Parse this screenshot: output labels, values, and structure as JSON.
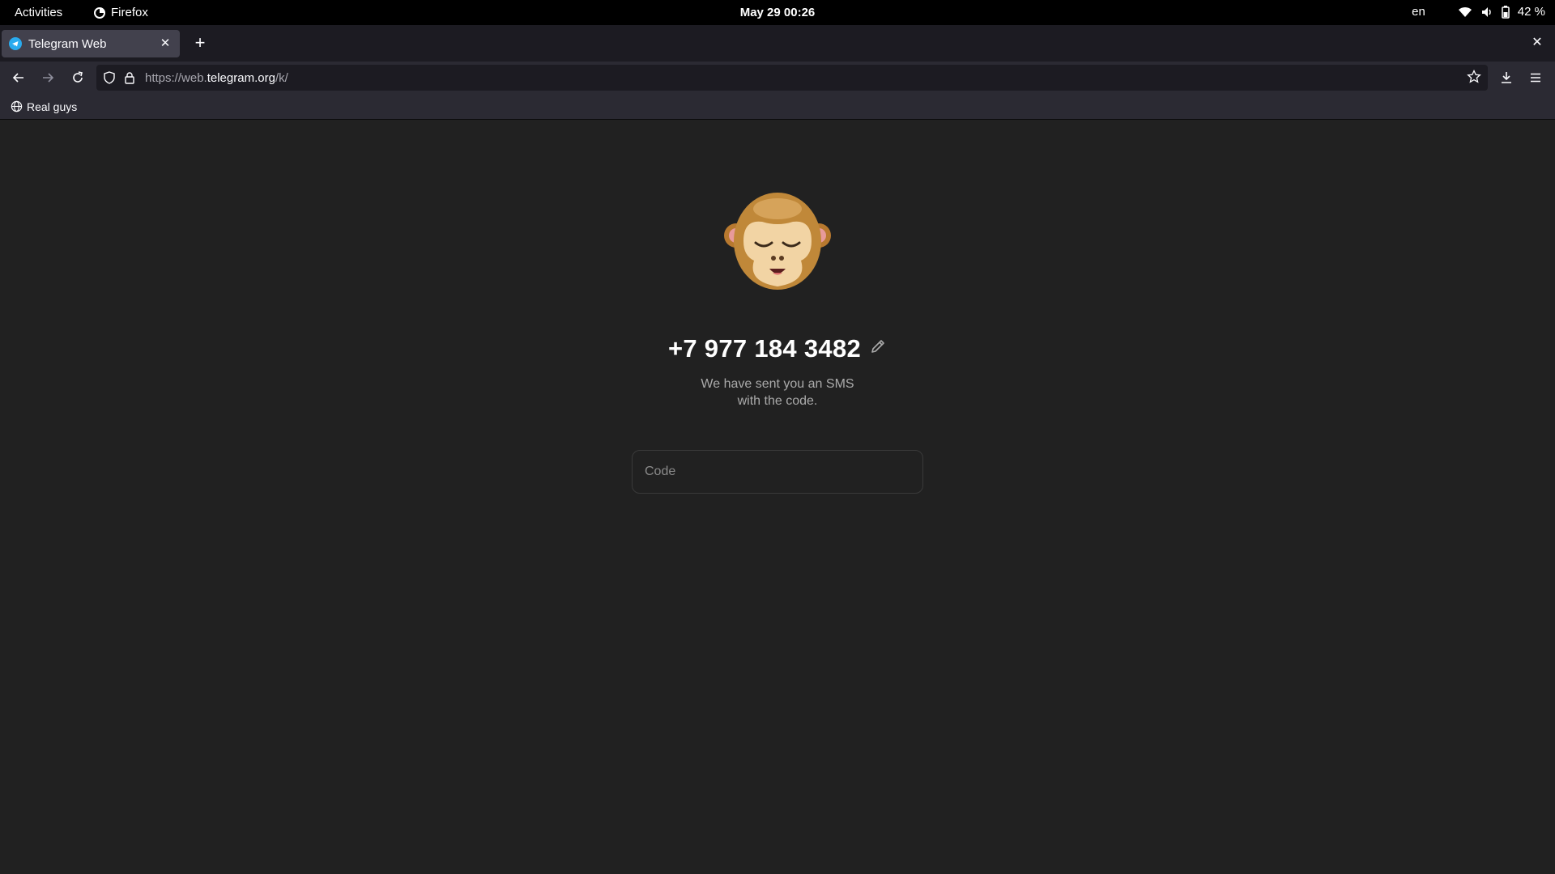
{
  "system": {
    "activities": "Activities",
    "app_name": "Firefox",
    "clock": "May 29  00:26",
    "language": "en",
    "battery": "42 %"
  },
  "browser": {
    "tab_title": "Telegram Web",
    "url_prefix": "https://web.",
    "url_domain": "telegram.org",
    "url_path": "/k/",
    "bookmark_label": "Real guys"
  },
  "login": {
    "phone": "+7 977 184 3482",
    "sms_line1": "We have sent you an SMS",
    "sms_line2": "with the code.",
    "code_placeholder": "Code"
  }
}
